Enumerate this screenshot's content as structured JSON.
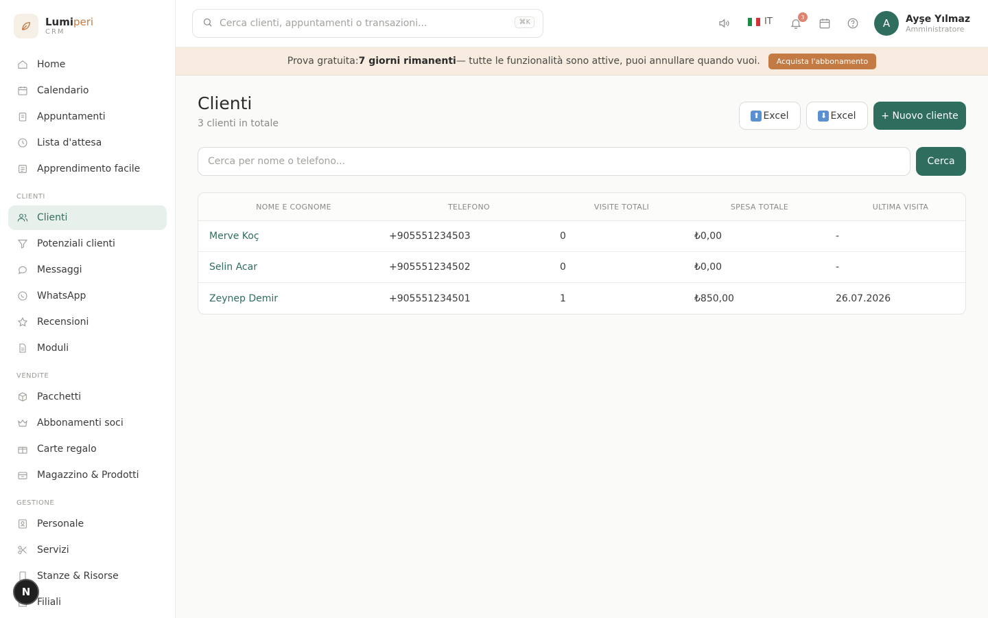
{
  "brand": {
    "name_primary": "Lumi",
    "name_accent": "peri",
    "sub": "CRM"
  },
  "sidebar": {
    "items": [
      {
        "label": "Home",
        "icon": "home-icon"
      },
      {
        "label": "Calendario",
        "icon": "calendar-icon"
      },
      {
        "label": "Appuntamenti",
        "icon": "clipboard-icon"
      },
      {
        "label": "Lista d'attesa",
        "icon": "clock-icon"
      },
      {
        "label": "Apprendimento facile",
        "icon": "book-icon"
      }
    ],
    "section_clienti": "CLIENTI",
    "clienti_items": [
      {
        "label": "Clienti",
        "icon": "users-icon",
        "active": true
      },
      {
        "label": "Potenziali clienti",
        "icon": "filter-icon"
      },
      {
        "label": "Messaggi",
        "icon": "chat-icon"
      },
      {
        "label": "WhatsApp",
        "icon": "whatsapp-icon"
      },
      {
        "label": "Recensioni",
        "icon": "star-icon"
      },
      {
        "label": "Moduli",
        "icon": "document-icon"
      }
    ],
    "section_vendite": "VENDITE",
    "vendite_items": [
      {
        "label": "Pacchetti",
        "icon": "box-icon"
      },
      {
        "label": "Abbonamenti soci",
        "icon": "crown-icon"
      },
      {
        "label": "Carte regalo",
        "icon": "gift-icon"
      },
      {
        "label": "Magazzino & Prodotti",
        "icon": "inventory-icon"
      }
    ],
    "section_gestione": "GESTIONE",
    "gestione_items": [
      {
        "label": "Personale",
        "icon": "person-badge-icon"
      },
      {
        "label": "Servizi",
        "icon": "scissors-icon"
      },
      {
        "label": "Stanze & Risorse",
        "icon": "door-icon"
      },
      {
        "label": "Filiali",
        "icon": "building-icon"
      }
    ]
  },
  "topbar": {
    "search_placeholder": "Cerca clienti, appuntamenti o transazioni...",
    "search_shortcut": "⌘K",
    "language": "IT",
    "notification_count": "3",
    "user_initial": "A",
    "user_name": "Ayşe Yılmaz",
    "user_role": "Amministratore"
  },
  "banner": {
    "prefix": "Prova gratuita: ",
    "highlight": "7 giorni rimanenti",
    "suffix": " — tutte le funzionalità sono attive, puoi annullare quando vuoi.",
    "button": "Acquista l'abbonamento"
  },
  "page": {
    "title": "Clienti",
    "subtitle": "3 clienti in totale",
    "import_label": "Excel",
    "export_label": "Excel",
    "new_client_label": "+ Nuovo cliente",
    "search_placeholder": "Cerca per nome o telefono...",
    "search_button": "Cerca"
  },
  "table": {
    "headers": [
      "NOME E COGNOME",
      "TELEFONO",
      "VISITE TOTALI",
      "SPESA TOTALE",
      "ULTIMA VISITA"
    ],
    "rows": [
      [
        "Merve Koç",
        "+905551234503",
        "0",
        "₺0,00",
        "-"
      ],
      [
        "Selin Acar",
        "+905551234502",
        "0",
        "₺0,00",
        "-"
      ],
      [
        "Zeynep Demir",
        "+905551234501",
        "1",
        "₺850,00",
        "26.07.2026"
      ]
    ]
  },
  "colors": {
    "accent": "#2f6d5f",
    "brand_orange": "#c47a43",
    "banner_bg": "#f7ecdf"
  },
  "floating_badge": "N"
}
